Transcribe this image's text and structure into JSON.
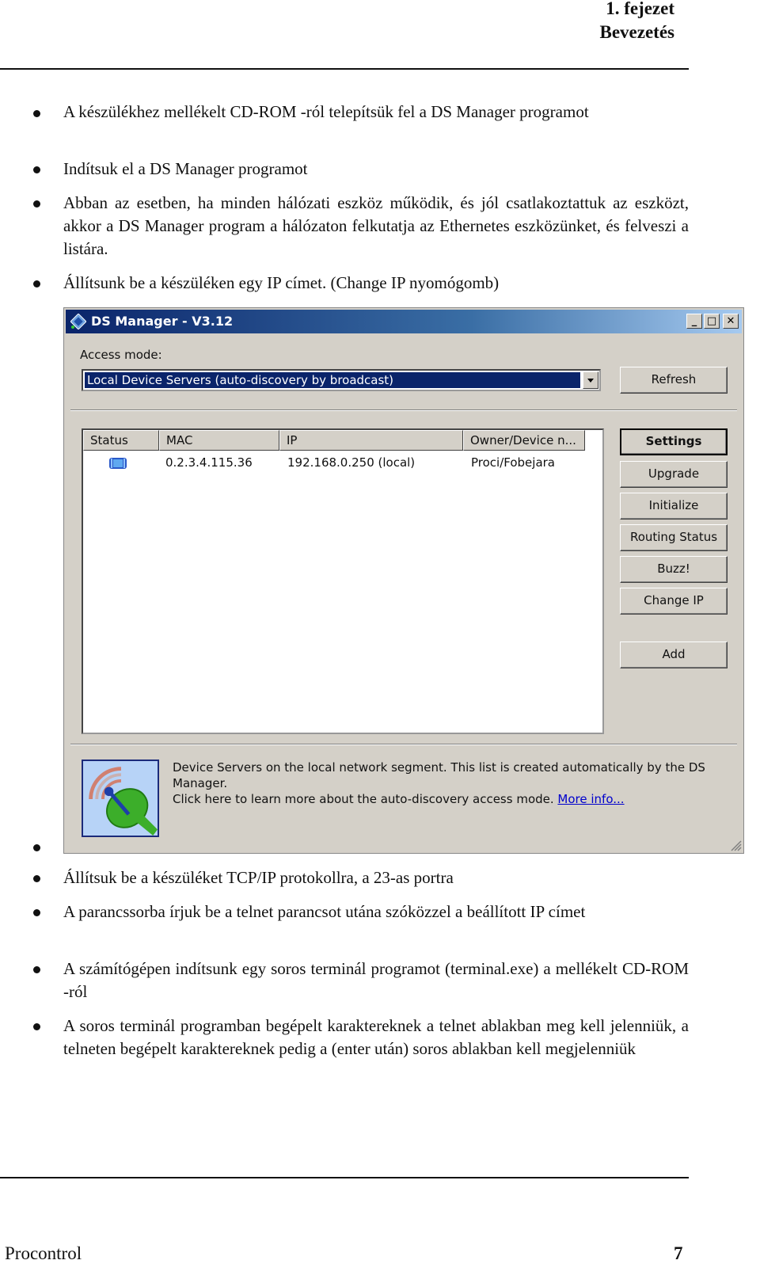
{
  "header": {
    "chapter": "1. fejezet",
    "section": "Bevezetés"
  },
  "bullets_top": [
    {
      "text": "A készülékhez mellékelt CD-ROM -ról telepítsük fel a DS Manager programot"
    },
    {
      "text": "Indítsuk el a DS Manager programot"
    },
    {
      "text": "Abban az esetben, ha minden hálózati eszköz működik, és jól csatlakoztattuk az eszközt, akkor a DS Manager program a hálózaton felkutatja az Ethernetes eszközünket, és felveszi a listára."
    },
    {
      "text": "Állítsunk be a készüléken egy IP címet. (Change IP nyomógomb)"
    }
  ],
  "window": {
    "title": "DS Manager - V3.12",
    "icon": "ds-manager-app-icon",
    "controls": {
      "minimize": "_",
      "maximize": "□",
      "close": "✕"
    },
    "access_mode_label": "Access mode:",
    "access_mode_value": "Local Device Servers (auto-discovery by broadcast)",
    "refresh_label": "Refresh",
    "columns": [
      "Status",
      "MAC",
      "IP",
      "Owner/Device n..."
    ],
    "rows": [
      {
        "status_icon": "device-online-icon",
        "mac": "0.2.3.4.115.36",
        "ip": "192.168.0.250 (local)",
        "owner": "Proci/Fobejara"
      }
    ],
    "buttons": [
      "Settings",
      "Upgrade",
      "Initialize",
      "Routing Status",
      "Buzz!",
      "Change IP",
      "Add"
    ],
    "info_icon": "satellite-dish-icon",
    "info_line1": "Device Servers on the local network segment. This list is created automatically by the DS Manager.",
    "info_line2": "Click here to learn more about the auto-discovery access mode.",
    "info_link": "More info..."
  },
  "bullets_bottom": [
    {
      "text": ""
    },
    {
      "text": "Állítsuk be a készüléket TCP/IP protokollra, a 23-as portra"
    },
    {
      "text": "A parancssorba írjuk be a telnet parancsot utána szóközzel a beállított IP címet"
    },
    {
      "text": "A számítógépen indítsunk egy soros terminál programot (terminal.exe) a mellékelt CD-ROM -ról"
    },
    {
      "text": "A soros terminál programban begépelt karaktereknek a telnet ablakban meg kell jelenniük, a telneten begépelt karaktereknek pedig a (enter után) soros ablakban kell megjelenniük"
    }
  ],
  "footer": {
    "left": "Procontrol",
    "page": "7"
  }
}
